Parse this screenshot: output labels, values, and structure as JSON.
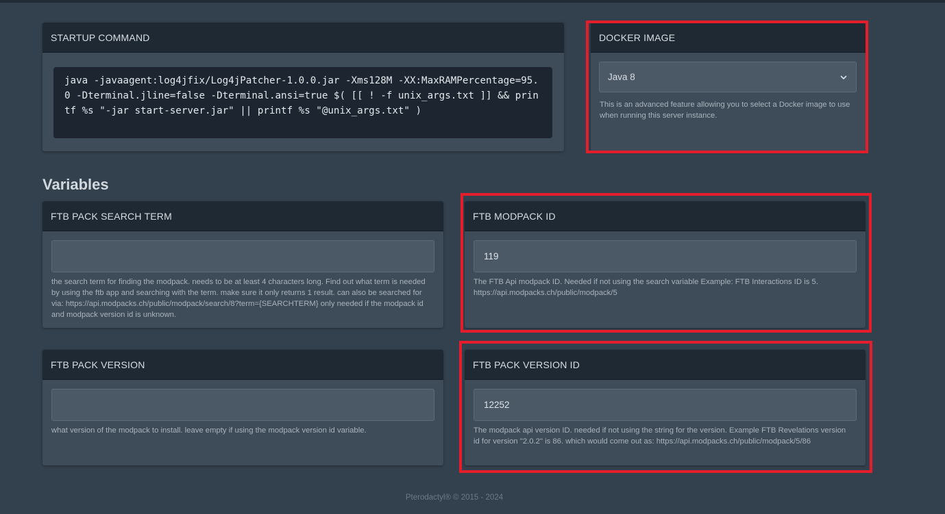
{
  "startup": {
    "header": "STARTUP COMMAND",
    "command": "java -javaagent:log4jfix/Log4jPatcher-1.0.0.jar -Xms128M -XX:MaxRAMPercentage=95.0 -Dterminal.jline=false -Dterminal.ansi=true $( [[ ! -f unix_args.txt ]] && printf %s \"-jar start-server.jar\" || printf %s \"@unix_args.txt\" )"
  },
  "docker": {
    "header": "DOCKER IMAGE",
    "selected": "Java 8",
    "help": "This is an advanced feature allowing you to select a Docker image to use when running this server instance."
  },
  "variables_title": "Variables",
  "variables": {
    "search_term": {
      "header": "FTB PACK SEARCH TERM",
      "value": "",
      "help": "the search term for finding the modpack. needs to be at least 4 characters long. Find out what term is needed by using the ftb app and searching with the term. make sure it only returns 1 result. can also be searched for via: https://api.modpacks.ch/public/modpack/search/8?term={SEARCHTERM}  only needed if the modpack id and modpack version id is unknown."
    },
    "modpack_id": {
      "header": "FTB MODPACK ID",
      "value": "119",
      "help": "The FTB Api modpack ID. Needed if not using the search variable  Example: FTB Interactions ID is 5. https://api.modpacks.ch/public/modpack/5"
    },
    "pack_version": {
      "header": "FTB PACK VERSION",
      "value": "",
      "help": "what version of the modpack to install. leave empty if using the modpack version id variable."
    },
    "pack_version_id": {
      "header": "FTB PACK VERSION ID",
      "value": "12252",
      "help": "The modpack api version ID. needed if not using the string for the version.  Example FTB Revelations version id for version \"2.0.2\" is 86. which would come out as: https://api.modpacks.ch/public/modpack/5/86"
    }
  },
  "footer": "Pterodactyl® © 2015 - 2024",
  "colors": {
    "background": "#33404d",
    "card": "#3e4b58",
    "card_header": "#1f2933",
    "highlight_frame": "#e51c2a"
  },
  "icons": {
    "select_arrow": "chevron-down-icon"
  }
}
